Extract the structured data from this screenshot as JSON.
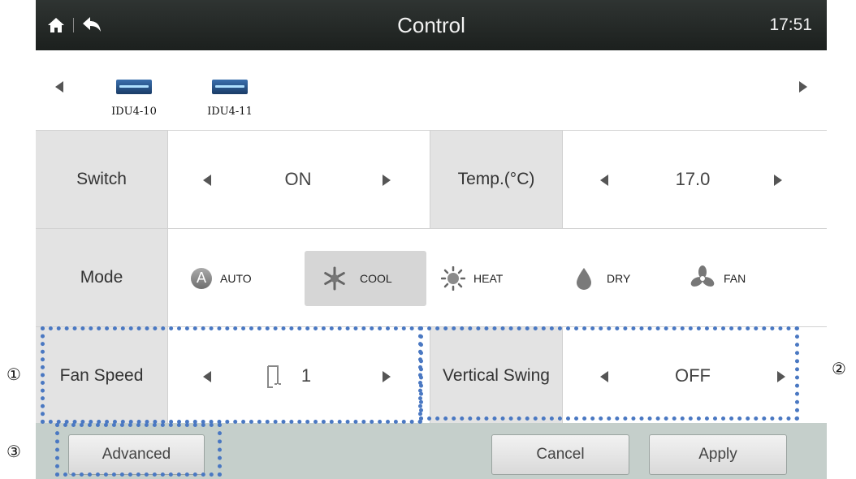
{
  "header": {
    "title": "Control",
    "time": "17:51",
    "home_icon": "home-icon",
    "back_icon": "back-arrow-icon"
  },
  "units": [
    {
      "name": "IDU4-10"
    },
    {
      "name": "IDU4-11"
    }
  ],
  "switch": {
    "label": "Switch",
    "value": "ON"
  },
  "temp": {
    "label": "Temp.(°C)",
    "value": "17.0"
  },
  "mode": {
    "label": "Mode",
    "selected": "COOL",
    "options": [
      {
        "label": "AUTO",
        "icon": "auto-mode-icon"
      },
      {
        "label": "COOL",
        "icon": "snowflake-icon"
      },
      {
        "label": "HEAT",
        "icon": "sun-icon"
      },
      {
        "label": "DRY",
        "icon": "droplet-icon"
      },
      {
        "label": "FAN",
        "icon": "fan-icon"
      }
    ]
  },
  "fan_speed": {
    "label": "Fan Speed",
    "value": "1",
    "icon": "fan-speed-icon"
  },
  "vertical_swing": {
    "label": "Vertical Swing",
    "value": "OFF"
  },
  "buttons": {
    "advanced": "Advanced",
    "cancel": "Cancel",
    "apply": "Apply"
  },
  "annotations": {
    "m1": "①",
    "m2": "②",
    "m3": "③"
  },
  "colors": {
    "header_bg": "#252a28",
    "bottom_bar": "#c5cfcb",
    "annotation_border": "#4a78c2",
    "label_cell": "#e3e3e3"
  }
}
